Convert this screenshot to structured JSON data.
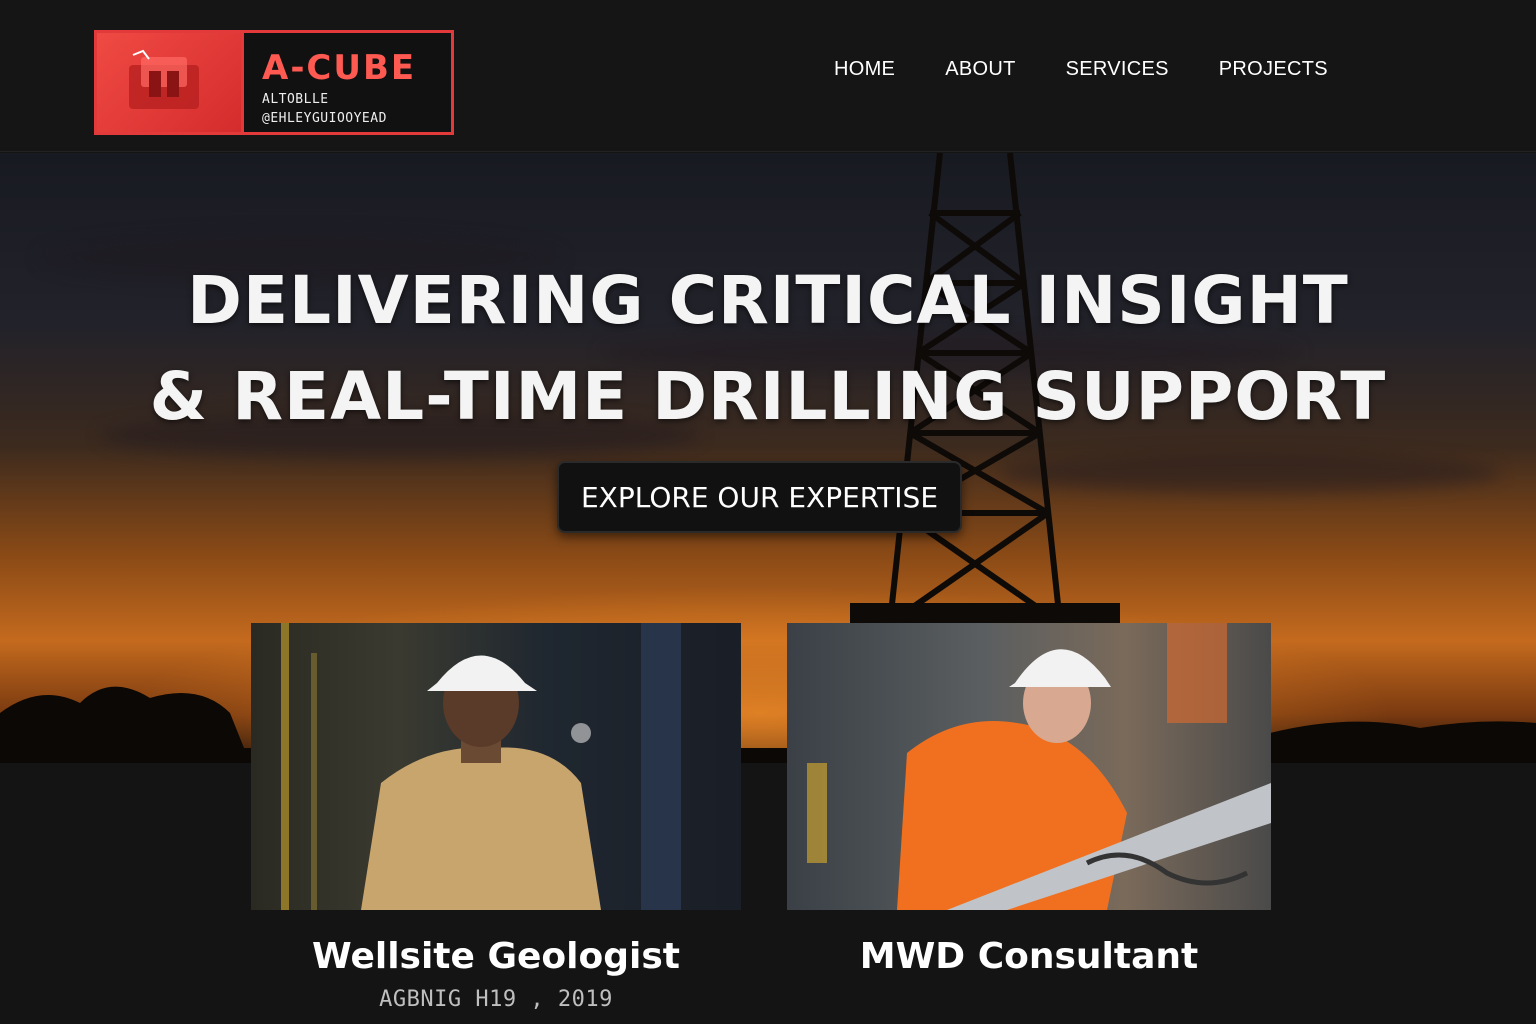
{
  "brand": {
    "title": "A-CUBE",
    "subtitle_line1": "ALTOBLLE",
    "subtitle_line2": "@EHLEYGUIOOYEAD",
    "accent_color": "#e23a3a"
  },
  "nav": {
    "items": [
      {
        "label": "HOME"
      },
      {
        "label": "ABOUT"
      },
      {
        "label": "SERVICES"
      },
      {
        "label": "PROJECTS"
      }
    ]
  },
  "hero": {
    "title_line1": "DELIVERING CRITICAL INSIGHT",
    "title_line2": "& REAL-TIME DRILLING SUPPORT",
    "cta_label": "EXPLORE OUR EXPERTISE"
  },
  "cards": [
    {
      "title": "Wellsite Geologist",
      "meta": "AGBNIG H19 , 2019",
      "image": "worker-in-tan-uniform-white-hardhat"
    },
    {
      "title": "MWD Consultant",
      "meta": "",
      "image": "worker-in-orange-coverall-white-hardhat"
    }
  ]
}
